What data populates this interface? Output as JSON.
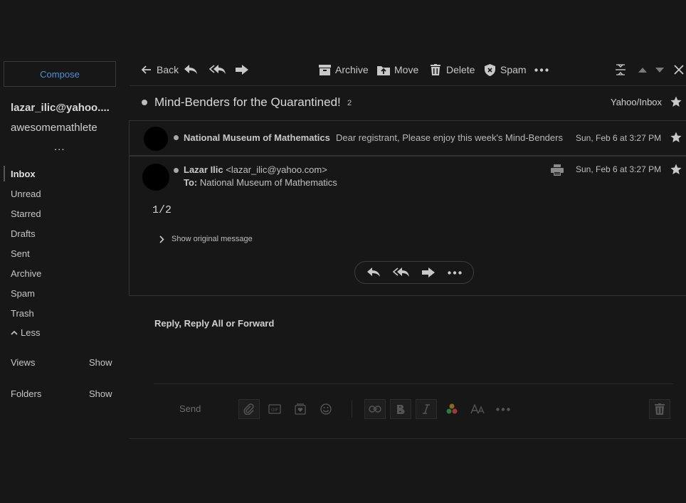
{
  "sidebar": {
    "compose_label": "Compose",
    "account_email": "lazar_ilic@yahoo....",
    "account_name": "awesomemathlete",
    "account_more": "...",
    "folders": [
      "Inbox",
      "Unread",
      "Starred",
      "Drafts",
      "Sent",
      "Archive",
      "Spam",
      "Trash"
    ],
    "less_label": "Less",
    "views_label": "Views",
    "views_show": "Show",
    "folders_label": "Folders",
    "folders_show": "Show"
  },
  "toolbar": {
    "back": "Back",
    "archive": "Archive",
    "move": "Move",
    "delete": "Delete",
    "spam": "Spam"
  },
  "thread": {
    "subject": "Mind-Benders for the Quarantined!",
    "count": "2",
    "folder_path": "Yahoo/Inbox"
  },
  "messages": [
    {
      "sender": "National Museum of Mathematics",
      "snippet": "Dear registrant, Please enjoy this week's Mind-Benders",
      "date": "Sun, Feb 6 at 3:27 PM"
    },
    {
      "sender_name": "Lazar Ilic",
      "sender_email": "<lazar_ilic@yahoo.com>",
      "to_label": "To:",
      "to_value": "National Museum of Mathematics",
      "date": "Sun, Feb 6 at 3:27 PM",
      "body": "1/2",
      "show_original": "Show original message"
    }
  ],
  "reply": {
    "heading": "Reply, Reply All or Forward",
    "send_label": "Send"
  },
  "colors": {
    "background": "#171717",
    "compose_text": "#4f8fd6",
    "border": "#333333"
  }
}
